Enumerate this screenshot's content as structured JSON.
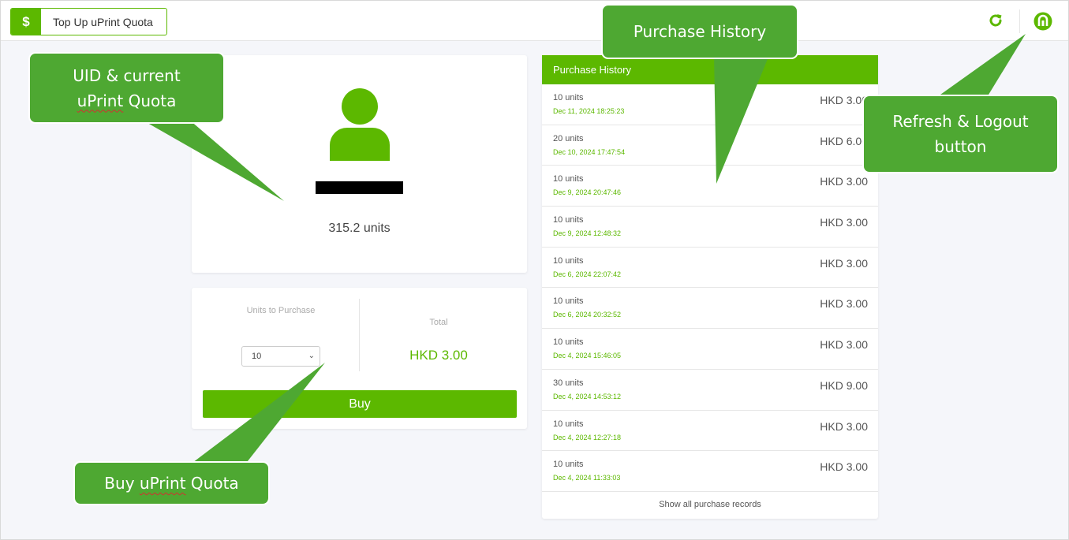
{
  "header": {
    "title": "Top Up uPrint Quota",
    "currency_icon": "$",
    "icons": [
      "refresh-icon",
      "logout-icon"
    ],
    "accent_color": "#5cb800"
  },
  "profile": {
    "quota": "315.2 units"
  },
  "purchase": {
    "units_label": "Units to Purchase",
    "units_selected": "10",
    "total_label": "Total",
    "total_value": "HKD 3.00",
    "buy_label": "Buy"
  },
  "history": {
    "title": "Purchase History",
    "rows": [
      {
        "units": "10 units",
        "date": "Dec 11, 2024 18:25:23",
        "price": "HKD 3.00"
      },
      {
        "units": "20 units",
        "date": "Dec 10, 2024 17:47:54",
        "price": "HKD 6.00"
      },
      {
        "units": "10 units",
        "date": "Dec 9, 2024 20:47:46",
        "price": "HKD 3.00"
      },
      {
        "units": "10 units",
        "date": "Dec 9, 2024 12:48:32",
        "price": "HKD 3.00"
      },
      {
        "units": "10 units",
        "date": "Dec 6, 2024 22:07:42",
        "price": "HKD 3.00"
      },
      {
        "units": "10 units",
        "date": "Dec 6, 2024 20:32:52",
        "price": "HKD 3.00"
      },
      {
        "units": "10 units",
        "date": "Dec 4, 2024 15:46:05",
        "price": "HKD 3.00"
      },
      {
        "units": "30 units",
        "date": "Dec 4, 2024 14:53:12",
        "price": "HKD 9.00"
      },
      {
        "units": "10 units",
        "date": "Dec 4, 2024 12:27:18",
        "price": "HKD 3.00"
      },
      {
        "units": "10 units",
        "date": "Dec 4, 2024 11:33:03",
        "price": "HKD 3.00"
      }
    ],
    "show_all_label": "Show all purchase records"
  },
  "callouts": {
    "uid_line1": "UID & current",
    "uid_line2_word": "uPrint",
    "uid_line2_rest": " Quota",
    "history": "Purchase History",
    "refresh_line1": "Refresh & Logout",
    "refresh_line2": "button",
    "buy_word1": "Buy ",
    "buy_word2": "uPrint",
    "buy_word3": " Quota",
    "fill_color": "#4ea832"
  }
}
